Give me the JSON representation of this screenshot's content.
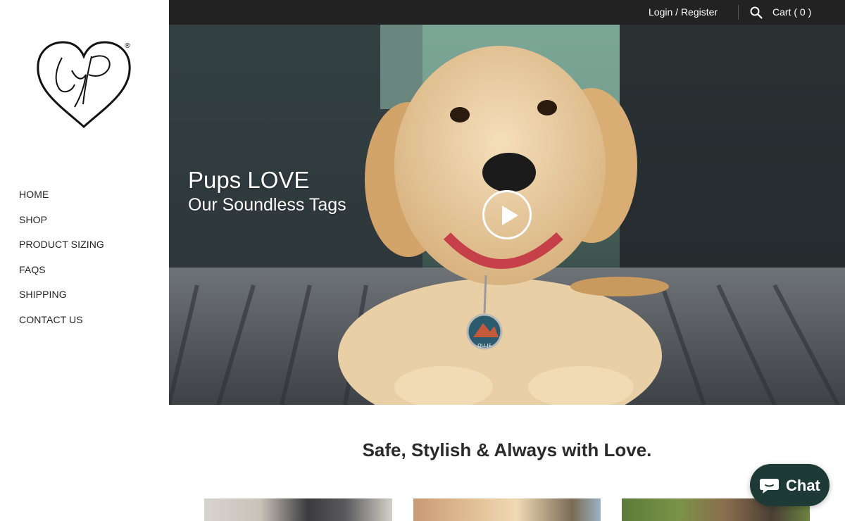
{
  "logo": {
    "text": "LYP",
    "registered": "®"
  },
  "nav": {
    "items": [
      {
        "label": "HOME"
      },
      {
        "label": "SHOP"
      },
      {
        "label": "PRODUCT SIZING"
      },
      {
        "label": "FAQS"
      },
      {
        "label": "SHIPPING"
      },
      {
        "label": "CONTACT US"
      }
    ]
  },
  "topbar": {
    "login_label": "Login",
    "separator": "/",
    "register_label": "Register",
    "search_icon": "search-icon",
    "cart_label": "Cart ( 0 )"
  },
  "hero": {
    "headline": "Pups LOVE",
    "subheadline": "Our Soundless Tags",
    "play_icon": "play-icon",
    "tag_name": "OLLIE"
  },
  "main": {
    "tagline": "Safe, Stylish & Always with Love."
  },
  "chat": {
    "label": "Chat",
    "icon": "chat-bubble-icon"
  },
  "colors": {
    "topbar_bg": "#222222",
    "chat_bg": "#1e3a36",
    "text": "#222222"
  }
}
